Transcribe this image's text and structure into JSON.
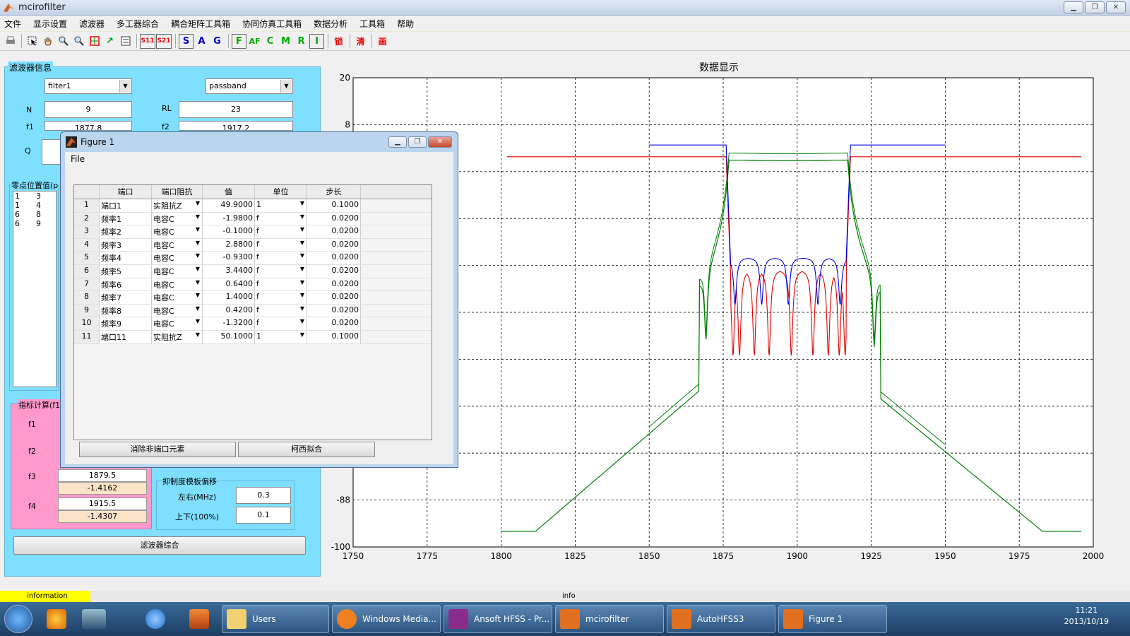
{
  "window": {
    "title": "mcirofilter"
  },
  "menu": [
    "文件",
    "显示设置",
    "滤波器",
    "多工器综合",
    "耦合矩阵工具箱",
    "协同仿真工具箱",
    "数据分析",
    "工具箱",
    "帮助"
  ],
  "toolbar": {
    "s11": "S11",
    "s21": "S21",
    "s": "S",
    "a": "A",
    "g": "G",
    "f": "F",
    "af": "AF",
    "c": "C",
    "m": "M",
    "r": "R",
    "i": "I",
    "lock": "锁",
    "clear": "清",
    "draw": "画"
  },
  "filter_panel": {
    "title": "滤波器信息",
    "filter_select": "filter1",
    "band_select": "passband",
    "n_label": "N",
    "n_value": "9",
    "rl_label": "RL",
    "rl_value": "23",
    "f1_label": "f1",
    "f1_value": "1877.8",
    "f2_label": "f2",
    "f2_value": "1917.2",
    "q_label": "Q",
    "zeros_title": "零点位置值(p",
    "zeros": [
      [
        "1",
        "3"
      ],
      [
        "1",
        "4"
      ],
      [
        "6",
        "8"
      ],
      [
        "6",
        "9"
      ]
    ],
    "index_title": "指标计算(f1",
    "index_labels": [
      "f1",
      "f2",
      "f3",
      "f4"
    ],
    "f3_value": "1879.5",
    "f3_sub": "-1.4162",
    "f4_value": "1915.5",
    "f4_sub": "-1.4307",
    "suppress_title": "抑制度模板偏移",
    "lr_label": "左右(MHz)",
    "lr_value": "0.3",
    "ud_label": "上下(100%)",
    "ud_value": "0.1",
    "synth_button": "滤波器综合"
  },
  "figure1": {
    "title": "Figure 1",
    "menu_file": "File",
    "columns": [
      "端口",
      "端口阻抗",
      "值",
      "单位",
      "步长"
    ],
    "rows": [
      {
        "n": "1",
        "port": "端口1",
        "imp": "实阻抗Z",
        "val": "49.9000",
        "unit": "1",
        "step": "0.1000"
      },
      {
        "n": "2",
        "port": "频率1",
        "imp": "电容C",
        "val": "-1.9800",
        "unit": "f",
        "step": "0.0200"
      },
      {
        "n": "3",
        "port": "频率2",
        "imp": "电容C",
        "val": "-0.1000",
        "unit": "f",
        "step": "0.0200"
      },
      {
        "n": "4",
        "port": "频率3",
        "imp": "电容C",
        "val": "2.8800",
        "unit": "f",
        "step": "0.0200"
      },
      {
        "n": "5",
        "port": "频率4",
        "imp": "电容C",
        "val": "-0.9300",
        "unit": "f",
        "step": "0.0200"
      },
      {
        "n": "6",
        "port": "频率5",
        "imp": "电容C",
        "val": "3.4400",
        "unit": "f",
        "step": "0.0200"
      },
      {
        "n": "7",
        "port": "频率6",
        "imp": "电容C",
        "val": "0.6400",
        "unit": "f",
        "step": "0.0200"
      },
      {
        "n": "8",
        "port": "频率7",
        "imp": "电容C",
        "val": "1.4000",
        "unit": "f",
        "step": "0.0200"
      },
      {
        "n": "9",
        "port": "频率8",
        "imp": "电容C",
        "val": "0.4200",
        "unit": "f",
        "step": "0.0200"
      },
      {
        "n": "10",
        "port": "频率9",
        "imp": "电容C",
        "val": "-1.3200",
        "unit": "f",
        "step": "0.0200"
      },
      {
        "n": "11",
        "port": "端口11",
        "imp": "实阻抗Z",
        "val": "50.1000",
        "unit": "1",
        "step": "0.1000"
      }
    ],
    "btn_clear": "消除非端口元素",
    "btn_fit": "柯西拟合"
  },
  "plot": {
    "title": "数据显示",
    "xlim": [
      1750,
      2000
    ],
    "ylim": [
      -100,
      20
    ],
    "xticks": [
      "1750",
      "1775",
      "1800",
      "1825",
      "1850",
      "1875",
      "1900",
      "1925",
      "1950",
      "1975",
      "2000"
    ],
    "yticks_shown": [
      "20",
      "8",
      "-88",
      "-100"
    ],
    "colors": {
      "red": "#e00000",
      "blue": "#0000e0",
      "green": "#008000"
    }
  },
  "status": {
    "left": "information",
    "mid": "info"
  },
  "taskbar": {
    "tasks": [
      "Users",
      "Windows Media...",
      "Ansoft HFSS - Pr...",
      "mcirofilter",
      "AutoHFSS3",
      "Figure 1"
    ],
    "time": "11:21",
    "date": "2013/10/19"
  }
}
